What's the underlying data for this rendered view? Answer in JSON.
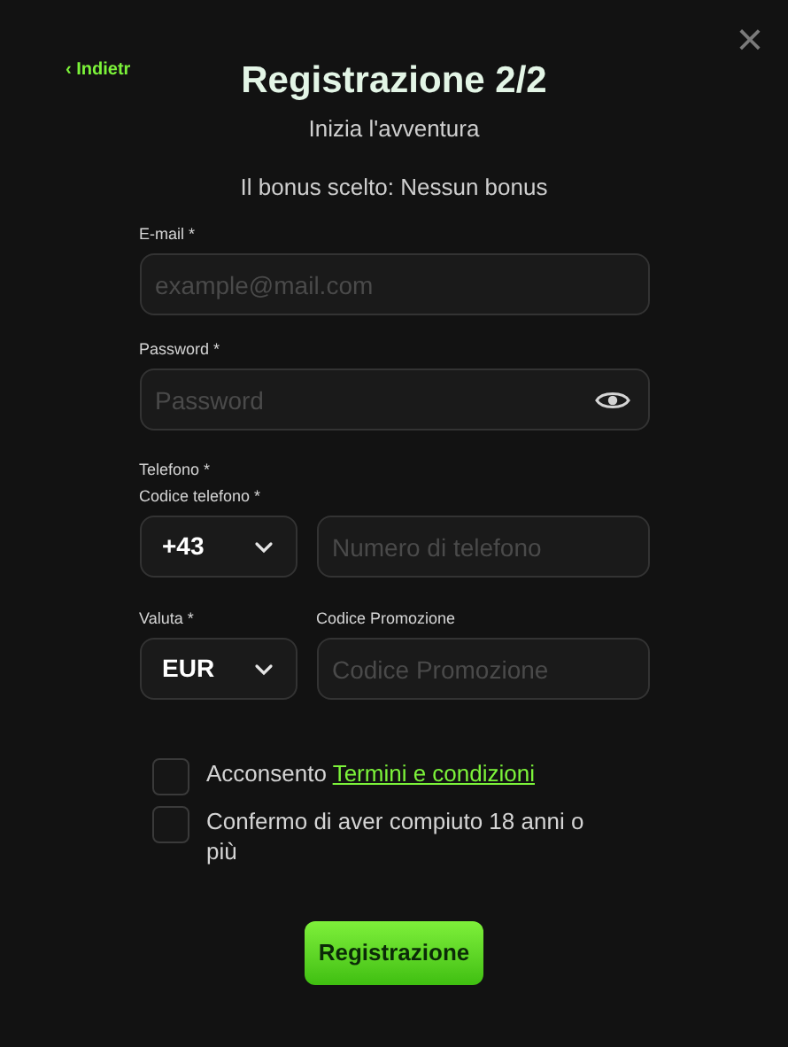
{
  "back_link": "Indietr",
  "back_icon": "‹",
  "close": "×",
  "title": "Registrazione 2/2",
  "subtitle": "Inizia l'avventura",
  "bonus": "Il bonus scelto: Nessun bonus",
  "email": {
    "label": "E-mail *",
    "placeholder": "example@mail.com"
  },
  "password": {
    "label": "Password *",
    "placeholder": "Password"
  },
  "phone_section": "Telefono *",
  "phone_code": {
    "label": "Codice telefono *",
    "value": "+43"
  },
  "phone_number": {
    "placeholder": "Numero di telefono"
  },
  "currency": {
    "label": "Valuta *",
    "value": "EUR"
  },
  "promo": {
    "label": "Codice Promozione",
    "placeholder": "Codice Promozione"
  },
  "checkboxes": [
    {
      "text": "Acconsento",
      "link": "Termini e condizioni",
      "checked": false
    },
    {
      "text": "Confermo di aver compiuto 18 anni o più",
      "checked": false
    }
  ],
  "submit": "Registrazione"
}
